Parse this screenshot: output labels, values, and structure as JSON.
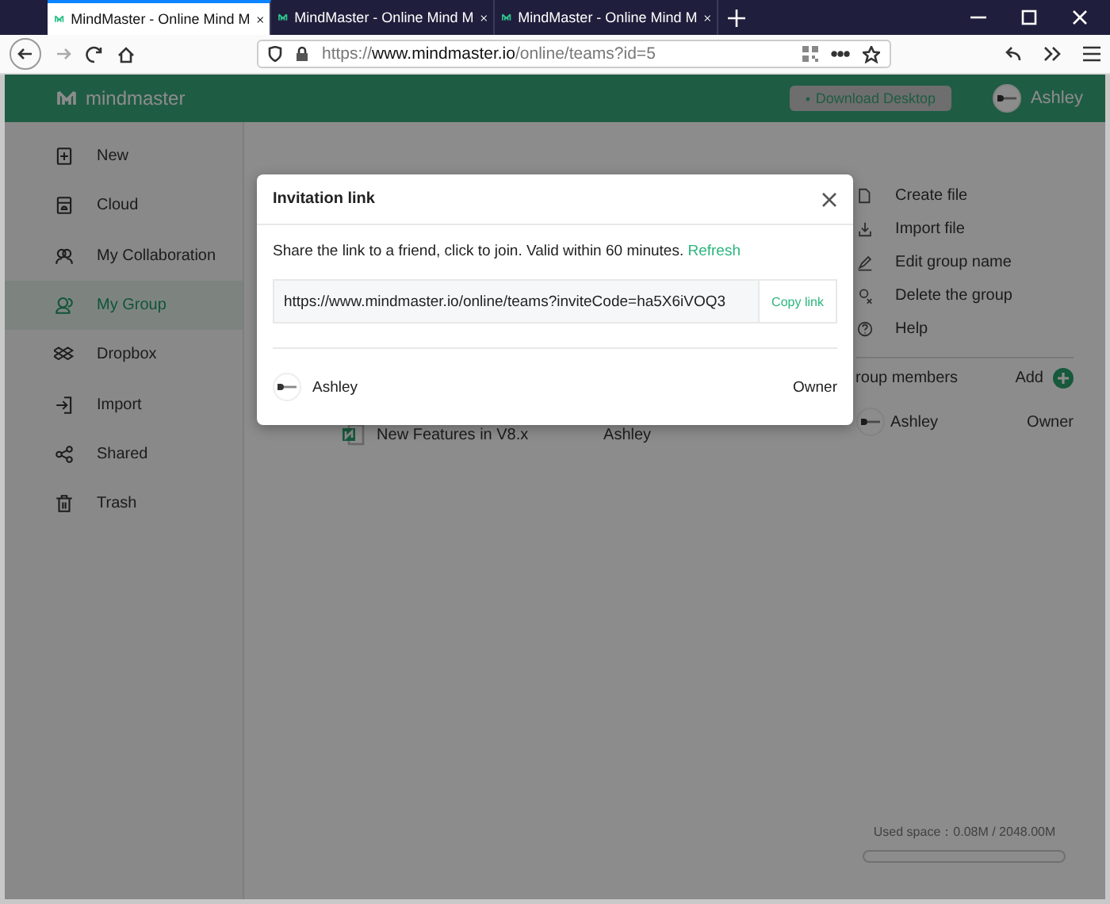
{
  "browser": {
    "tabs": [
      {
        "title": "MindMaster - Online Mind M",
        "selected": true
      },
      {
        "title": "MindMaster - Online Mind M",
        "selected": false
      },
      {
        "title": "MindMaster - Online Mind M",
        "selected": false
      }
    ],
    "url": "https://**www.mindmaster.io**/online/teams?id=5"
  },
  "header": {
    "logo": "mindmaster",
    "download_button": "Download Desktop",
    "user_name": "Ashley"
  },
  "sidebar": {
    "items": [
      {
        "label": "New",
        "selected": false
      },
      {
        "label": "Cloud",
        "selected": false
      },
      {
        "label": "My Collaboration",
        "selected": false
      },
      {
        "label": "My Group",
        "selected": true
      },
      {
        "label": "Dropbox",
        "selected": false
      },
      {
        "label": "Import",
        "selected": false
      },
      {
        "label": "Shared",
        "selected": false
      },
      {
        "label": "Trash",
        "selected": false
      }
    ]
  },
  "files": [
    {
      "name": "New Features in V8.x",
      "owner": "Ashley"
    }
  ],
  "group_panel": {
    "actions": [
      "Create file",
      "Import file",
      "Edit group name",
      "Delete the group",
      "Help"
    ],
    "members_heading": "roup members",
    "add": "Add",
    "members": [
      {
        "name": "Ashley",
        "role": "Owner"
      }
    ],
    "storage": {
      "label": "Used space：0.08M / 2048.00M",
      "level": 0
    }
  },
  "modal": {
    "title": "Invitation link",
    "message": "Share the link to a friend, click to join. Valid within 60 minutes.",
    "refresh": "Refresh",
    "link": "https://www.mindmaster.io/online/teams?inviteCode=ha5X6iVOQ3",
    "copy": "Copy link",
    "members": [
      {
        "name": "Ashley",
        "role": "Owner"
      }
    ]
  }
}
